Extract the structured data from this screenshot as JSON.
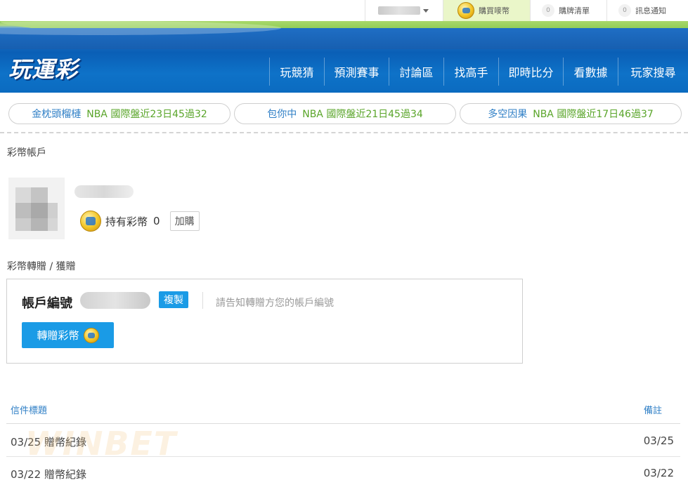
{
  "topbar": {
    "buy_coins": "購買嘜幣",
    "cart": {
      "count": "0",
      "label": "購牌清單"
    },
    "messages": {
      "count": "0",
      "label": "訊息通知"
    }
  },
  "logo": "玩運彩",
  "nav": [
    {
      "label": "玩競猜",
      "w": 78
    },
    {
      "label": "預測賽事",
      "w": 92
    },
    {
      "label": "討論區",
      "w": 78
    },
    {
      "label": "找高手",
      "w": 78
    },
    {
      "label": "即時比分",
      "w": 92
    },
    {
      "label": "看數據",
      "w": 78
    },
    {
      "label": "玩家搜尋",
      "w": 100
    }
  ],
  "tickers": [
    {
      "name": "金枕頭榴槤",
      "info": "NBA 國際盤近23日45過32"
    },
    {
      "name": "包你中",
      "info": "NBA 國際盤近21日45過34"
    },
    {
      "name": "多空因果",
      "info": "NBA 國際盤近17日46過37"
    }
  ],
  "account": {
    "section_title": "彩幣帳戶",
    "holding_label": "持有彩幣",
    "holding_count": "0",
    "add_button": "加購"
  },
  "transfer": {
    "section_title": "彩幣轉贈 / 獲贈",
    "account_label": "帳戶編號",
    "copy_button": "複製",
    "hint": "請告知轉贈方您的帳戶編號",
    "send_button": "轉贈彩幣"
  },
  "records": {
    "headers": {
      "title": "信件標題",
      "note": "備註"
    },
    "rows": [
      {
        "title": "03/25 贈幣紀錄",
        "note": "03/25"
      },
      {
        "title": "03/22 贈幣紀錄",
        "note": "03/22"
      }
    ]
  },
  "watermark": "WINBET"
}
